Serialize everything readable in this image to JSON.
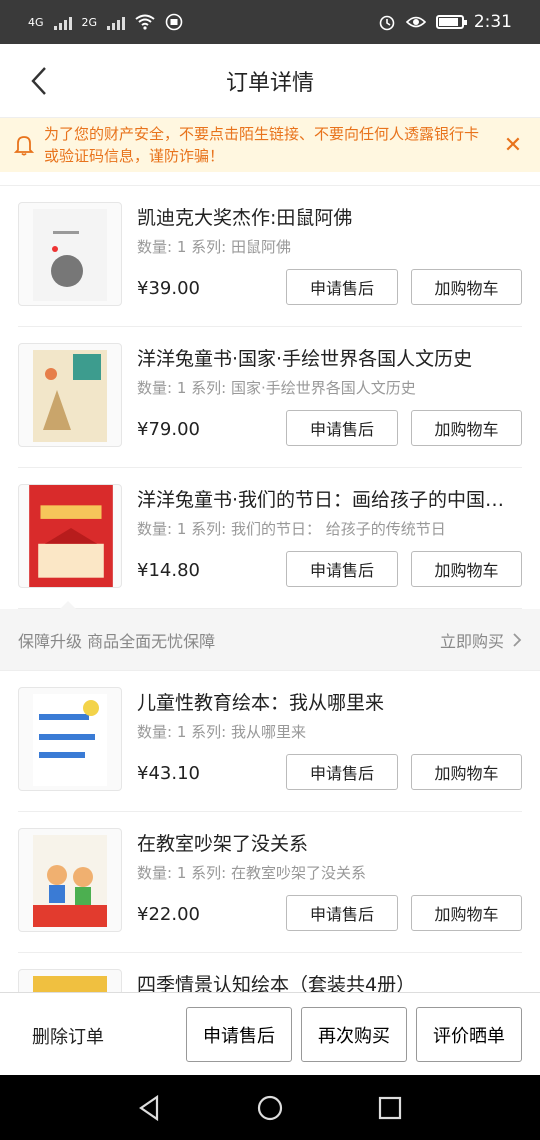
{
  "status_bar": {
    "net1": "4G",
    "net2": "2G",
    "time": "2:31",
    "battery_level": 0.85
  },
  "header": {
    "title": "订单详情"
  },
  "notice": {
    "text": "为了您的财产安全，不要点击陌生链接、不要向任何人透露银行卡或验证码信息，谨防诈骗！"
  },
  "items": [
    {
      "title": "凯迪克大奖杰作:田鼠阿佛",
      "meta": "数量: 1 系列: 田鼠阿佛",
      "price": "¥39.00",
      "after_sale": "申请售后",
      "add_cart": "加购物车",
      "cover_colors": [
        "#f4f4f4",
        "#777777"
      ]
    },
    {
      "title": "洋洋兔童书·国家·手绘世界各国人文历史",
      "meta": "数量: 1 系列: 国家·手绘世界各国人文历史",
      "price": "¥79.00",
      "after_sale": "申请售后",
      "add_cart": "加购物车",
      "cover_colors": [
        "#f2e6c9",
        "#3d9c8e"
      ]
    },
    {
      "title": "洋洋兔童书·我们的节日：画给孩子的中国传统节日",
      "meta": "数量: 1 系列: 我们的节日： 给孩子的传统节日",
      "price": "¥14.80",
      "after_sale": "申请售后",
      "add_cart": "加购物车",
      "cover_colors": [
        "#d92b2b",
        "#f6c65a"
      ]
    },
    {
      "title": "儿童性教育绘本：我从哪里来",
      "meta": "数量: 1 系列: 我从哪里来",
      "price": "¥43.10",
      "after_sale": "申请售后",
      "add_cart": "加购物车",
      "cover_colors": [
        "#ffffff",
        "#3a7bd5"
      ]
    },
    {
      "title": "在教室吵架了没关系",
      "meta": "数量: 1 系列: 在教室吵架了没关系",
      "price": "¥22.00",
      "after_sale": "申请售后",
      "add_cart": "加购物车",
      "cover_colors": [
        "#f7f3ea",
        "#e23b2e"
      ]
    },
    {
      "title": "四季情景认知绘本（套装共4册）",
      "meta": "",
      "price": "",
      "after_sale": "",
      "add_cart": "",
      "cover_colors": [
        "#8fc65a",
        "#f0c040"
      ]
    }
  ],
  "guarantee": {
    "text": "保障升级 商品全面无忧保障",
    "link": "立即购买"
  },
  "bottom_bar": {
    "delete": "删除订单",
    "after_sale": "申请售后",
    "rebuy": "再次购买",
    "review": "评价晒单"
  },
  "colors": {
    "accent": "#e8731c",
    "notice_bg": "#fff7e0",
    "status_bg": "#3a3a3a"
  }
}
